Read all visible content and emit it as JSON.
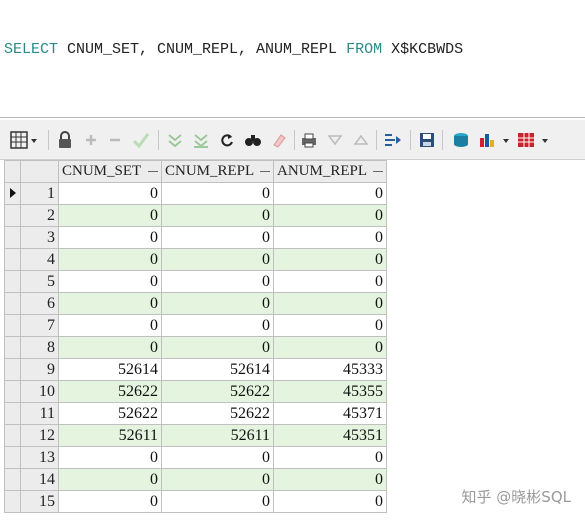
{
  "editor": {
    "kw_select": "SELECT",
    "cols_text": " CNUM_SET, CNUM_REPL, ANUM_REPL ",
    "kw_from": "FROM",
    "table_text": " X$KCBWDS"
  },
  "toolbar": {
    "icons": [
      "grid-view-icon",
      "lock-icon",
      "add-record-icon",
      "delete-record-icon",
      "post-icon",
      "filter-down-icon",
      "filter-clear-icon",
      "refresh-icon",
      "find-icon",
      "eraser-icon",
      "print-icon",
      "sort-desc-icon",
      "sort-asc-icon",
      "export-icon",
      "save-icon",
      "clear-icon",
      "chart-icon",
      "table-icon"
    ]
  },
  "grid": {
    "columns": [
      "CNUM_SET",
      "CNUM_REPL",
      "ANUM_REPL"
    ],
    "rows": [
      {
        "n": "1",
        "v": [
          "0",
          "0",
          "0"
        ]
      },
      {
        "n": "2",
        "v": [
          "0",
          "0",
          "0"
        ]
      },
      {
        "n": "3",
        "v": [
          "0",
          "0",
          "0"
        ]
      },
      {
        "n": "4",
        "v": [
          "0",
          "0",
          "0"
        ]
      },
      {
        "n": "5",
        "v": [
          "0",
          "0",
          "0"
        ]
      },
      {
        "n": "6",
        "v": [
          "0",
          "0",
          "0"
        ]
      },
      {
        "n": "7",
        "v": [
          "0",
          "0",
          "0"
        ]
      },
      {
        "n": "8",
        "v": [
          "0",
          "0",
          "0"
        ]
      },
      {
        "n": "9",
        "v": [
          "52614",
          "52614",
          "45333"
        ]
      },
      {
        "n": "10",
        "v": [
          "52622",
          "52622",
          "45355"
        ]
      },
      {
        "n": "11",
        "v": [
          "52622",
          "52622",
          "45371"
        ]
      },
      {
        "n": "12",
        "v": [
          "52611",
          "52611",
          "45351"
        ]
      },
      {
        "n": "13",
        "v": [
          "0",
          "0",
          "0"
        ]
      },
      {
        "n": "14",
        "v": [
          "0",
          "0",
          "0"
        ]
      },
      {
        "n": "15",
        "v": [
          "0",
          "0",
          "0"
        ]
      }
    ]
  },
  "watermark": "知乎 @晓彬SQL",
  "colors": {
    "keyword": "#2b8a8a",
    "alt_row": "#e4f4df"
  }
}
